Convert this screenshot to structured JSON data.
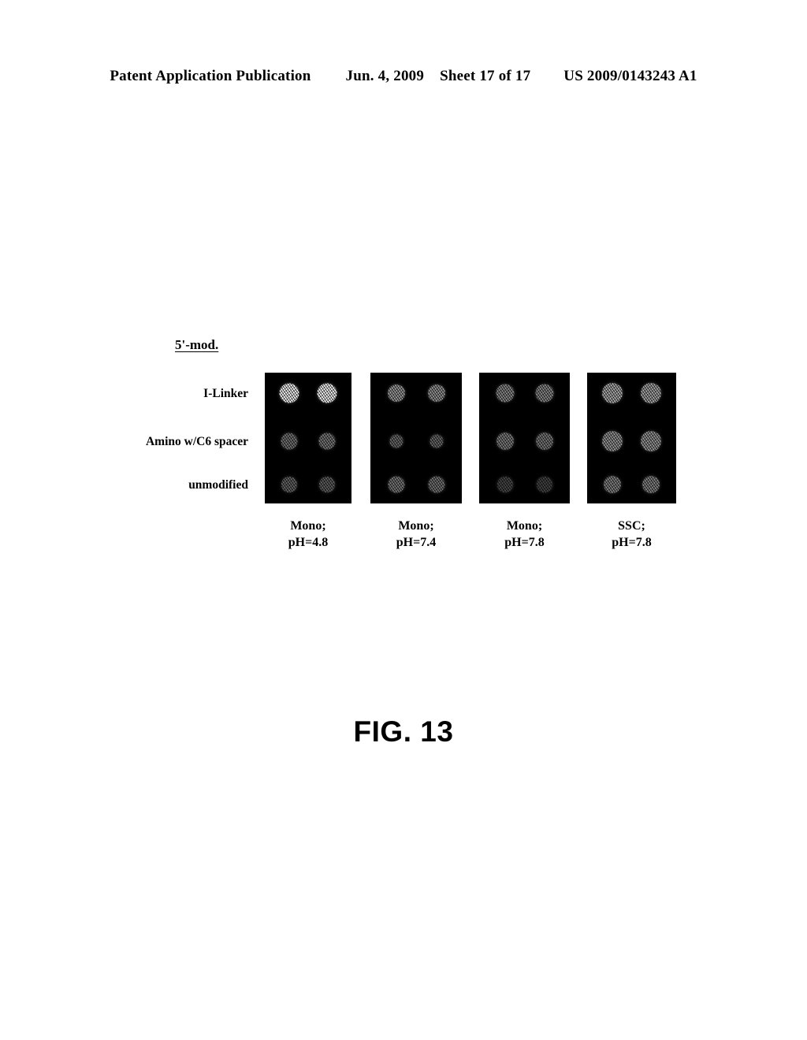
{
  "header": {
    "publication": "Patent Application Publication",
    "date": "Jun. 4, 2009",
    "sheet": "Sheet 17 of 17",
    "patent_number": "US 2009/0143243 A1"
  },
  "figure": {
    "caption": "FIG. 13",
    "axis_title": "5'-mod.",
    "row_labels": [
      "I-Linker",
      "Amino w/C6 spacer",
      "unmodified"
    ],
    "column_labels": [
      {
        "line1": "Mono;",
        "line2": "pH=4.8"
      },
      {
        "line1": "Mono;",
        "line2": "pH=7.4"
      },
      {
        "line1": "Mono;",
        "line2": "pH=7.8"
      },
      {
        "line1": "SSC;",
        "line2": "pH=7.8"
      }
    ],
    "background_color": "#000000",
    "spot_color": "#ffffff"
  },
  "chart_data": {
    "type": "heatmap",
    "title": "FIG. 13",
    "description": "Microarray fluorescence scan: four hybridization-buffer panels, each with three rows of 5'-modification chemistries printed in duplicate spots.",
    "xlabel": "",
    "ylabel": "5'-mod.",
    "row_categories": [
      "I-Linker",
      "Amino w/C6 spacer",
      "unmodified"
    ],
    "column_categories": [
      "Mono; pH=4.8",
      "Mono; pH=7.4",
      "Mono; pH=7.8",
      "SSC; pH=7.8"
    ],
    "replicates_per_cell": 2,
    "intensity_scale": [
      0,
      1
    ],
    "grid": false,
    "legend": "none",
    "panels": [
      {
        "column": "Mono; pH=4.8",
        "rows": [
          {
            "label": "I-Linker",
            "intensity": 1.0,
            "diameter": 25,
            "spots": [
              {
                "intensity": 1.0,
                "diameter": 25
              },
              {
                "intensity": 1.0,
                "diameter": 25
              }
            ]
          },
          {
            "label": "Amino w/C6 spacer",
            "intensity": 0.58,
            "diameter": 21,
            "spots": [
              {
                "intensity": 0.58,
                "diameter": 21
              },
              {
                "intensity": 0.6,
                "diameter": 21
              }
            ]
          },
          {
            "label": "unmodified",
            "intensity": 0.52,
            "diameter": 20,
            "spots": [
              {
                "intensity": 0.52,
                "diameter": 20
              },
              {
                "intensity": 0.5,
                "diameter": 20
              }
            ]
          }
        ]
      },
      {
        "column": "Mono; pH=7.4",
        "rows": [
          {
            "label": "I-Linker",
            "intensity": 0.72,
            "diameter": 22,
            "spots": [
              {
                "intensity": 0.72,
                "diameter": 22
              },
              {
                "intensity": 0.7,
                "diameter": 22
              }
            ]
          },
          {
            "label": "Amino w/C6 spacer",
            "intensity": 0.55,
            "diameter": 17,
            "spots": [
              {
                "intensity": 0.55,
                "diameter": 17
              },
              {
                "intensity": 0.54,
                "diameter": 17
              }
            ]
          },
          {
            "label": "unmodified",
            "intensity": 0.6,
            "diameter": 21,
            "spots": [
              {
                "intensity": 0.6,
                "diameter": 21
              },
              {
                "intensity": 0.58,
                "diameter": 21
              }
            ]
          }
        ]
      },
      {
        "column": "Mono; pH=7.8",
        "rows": [
          {
            "label": "I-Linker",
            "intensity": 0.66,
            "diameter": 23,
            "spots": [
              {
                "intensity": 0.66,
                "diameter": 23
              },
              {
                "intensity": 0.66,
                "diameter": 23
              }
            ]
          },
          {
            "label": "Amino w/C6 spacer",
            "intensity": 0.62,
            "diameter": 22,
            "spots": [
              {
                "intensity": 0.62,
                "diameter": 22
              },
              {
                "intensity": 0.6,
                "diameter": 22
              }
            ]
          },
          {
            "label": "unmodified",
            "intensity": 0.4,
            "diameter": 20,
            "spots": [
              {
                "intensity": 0.4,
                "diameter": 20
              },
              {
                "intensity": 0.38,
                "diameter": 20
              }
            ]
          }
        ]
      },
      {
        "column": "SSC; pH=7.8",
        "rows": [
          {
            "label": "I-Linker",
            "intensity": 0.78,
            "diameter": 26,
            "spots": [
              {
                "intensity": 0.78,
                "diameter": 26
              },
              {
                "intensity": 0.76,
                "diameter": 26
              }
            ]
          },
          {
            "label": "Amino w/C6 spacer",
            "intensity": 0.7,
            "diameter": 26,
            "spots": [
              {
                "intensity": 0.7,
                "diameter": 26
              },
              {
                "intensity": 0.7,
                "diameter": 26
              }
            ]
          },
          {
            "label": "unmodified",
            "intensity": 0.64,
            "diameter": 22,
            "spots": [
              {
                "intensity": 0.64,
                "diameter": 22
              },
              {
                "intensity": 0.64,
                "diameter": 22
              }
            ]
          }
        ]
      }
    ]
  }
}
